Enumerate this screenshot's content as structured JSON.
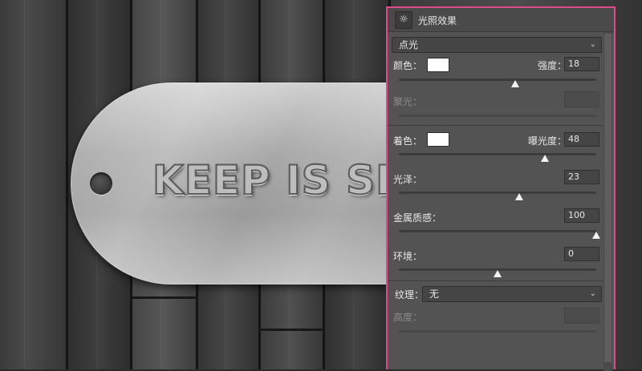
{
  "tag": {
    "text": "KEEP IS SIMPLE"
  },
  "panel": {
    "title": "光照效果",
    "light_type": {
      "value": "点光"
    },
    "color": {
      "label": "颜色：",
      "swatch_color": "#ffffff"
    },
    "intensity": {
      "label": "强度：",
      "value": "18",
      "slider_fraction": 0.59
    },
    "hotspot": {
      "label": "聚光：",
      "value": "",
      "disabled": true
    },
    "colorize": {
      "label": "着色：",
      "swatch_color": "#ffffff"
    },
    "exposure": {
      "label": "曝光度：",
      "value": "48",
      "slider_fraction": 0.74
    },
    "gloss": {
      "label": "光泽：",
      "value": "23",
      "slider_fraction": 0.61
    },
    "metallic": {
      "label": "金属质感：",
      "value": "100",
      "slider_fraction": 1.0
    },
    "ambience": {
      "label": "环境：",
      "value": "0",
      "slider_fraction": 0.5
    },
    "texture": {
      "label": "纹理：",
      "value": "无"
    },
    "height": {
      "label": "高度：",
      "value": "",
      "disabled": true
    }
  },
  "colors": {
    "panel_border": "#e04a8a",
    "panel_bg": "#535353"
  }
}
